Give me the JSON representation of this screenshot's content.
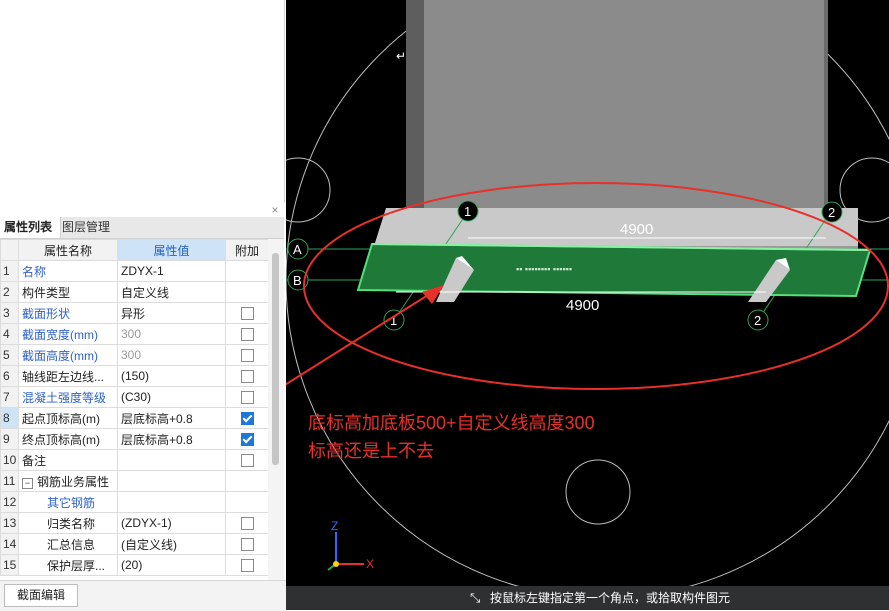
{
  "panel": {
    "close_glyph": "×",
    "tabs": [
      "属性列表",
      "图层管理"
    ],
    "headers": {
      "name": "属性名称",
      "value": "属性值",
      "extra": "附加"
    },
    "rows": [
      {
        "n": "1",
        "name": "名称",
        "value": "ZDYX-1",
        "nameColor": "blue",
        "valueColor": "normal",
        "check": "none"
      },
      {
        "n": "2",
        "name": "构件类型",
        "value": "自定义线",
        "nameColor": "normal",
        "valueColor": "normal",
        "check": "none"
      },
      {
        "n": "3",
        "name": "截面形状",
        "value": "异形",
        "nameColor": "blue",
        "valueColor": "normal",
        "check": "off"
      },
      {
        "n": "4",
        "name": "截面宽度(mm)",
        "value": "300",
        "nameColor": "blue",
        "valueColor": "grey",
        "check": "off"
      },
      {
        "n": "5",
        "name": "截面高度(mm)",
        "value": "300",
        "nameColor": "blue",
        "valueColor": "grey",
        "check": "off"
      },
      {
        "n": "6",
        "name": "轴线距左边线...",
        "value": "(150)",
        "nameColor": "normal",
        "valueColor": "normal",
        "check": "off"
      },
      {
        "n": "7",
        "name": "混凝土强度等级",
        "value": "(C30)",
        "nameColor": "blue",
        "valueColor": "normal",
        "check": "off"
      },
      {
        "n": "8",
        "name": "起点顶标高(m)",
        "value": "层底标高+0.8",
        "nameColor": "normal",
        "valueColor": "normal",
        "check": "on",
        "selected": true
      },
      {
        "n": "9",
        "name": "终点顶标高(m)",
        "value": "层底标高+0.8",
        "nameColor": "normal",
        "valueColor": "normal",
        "check": "on"
      },
      {
        "n": "10",
        "name": "备注",
        "value": "",
        "nameColor": "normal",
        "valueColor": "normal",
        "check": "off"
      },
      {
        "n": "11",
        "name": "钢筋业务属性",
        "value": "",
        "nameColor": "normal",
        "valueColor": "normal",
        "check": "none",
        "group": true
      },
      {
        "n": "12",
        "name": "其它钢筋",
        "value": "",
        "nameColor": "blue",
        "valueColor": "normal",
        "check": "none",
        "indent": true
      },
      {
        "n": "13",
        "name": "归类名称",
        "value": "(ZDYX-1)",
        "nameColor": "normal",
        "valueColor": "normal",
        "check": "off",
        "indent": true
      },
      {
        "n": "14",
        "name": "汇总信息",
        "value": "(自定义线)",
        "nameColor": "normal",
        "valueColor": "normal",
        "check": "off",
        "indent": true
      },
      {
        "n": "15",
        "name": "保护层厚...",
        "value": "(20)",
        "nameColor": "normal",
        "valueColor": "normal",
        "check": "off",
        "indent": true
      }
    ],
    "expand_glyph": "−",
    "section_edit": "截面编辑"
  },
  "viewport": {
    "dims": {
      "top": "4900",
      "bottom": "4900"
    },
    "axis_numbers": {
      "top_left": "1",
      "top_right": "2",
      "bottom_left": "1",
      "bottom_right": "2"
    },
    "axis_letters": {
      "a": "A",
      "b": "B"
    },
    "annotation": {
      "line1": "底标高加底板500+自定义线高度300",
      "line2": "标高还是上不去"
    },
    "gizmo": {
      "z": "Z",
      "x": "X"
    },
    "annotation_color": "#e8302a",
    "beam_color": "#1f7a3a"
  },
  "status": {
    "icon": "crosshair-icon",
    "text": "按鼠标左键指定第一个角点，或拾取构件图元"
  }
}
